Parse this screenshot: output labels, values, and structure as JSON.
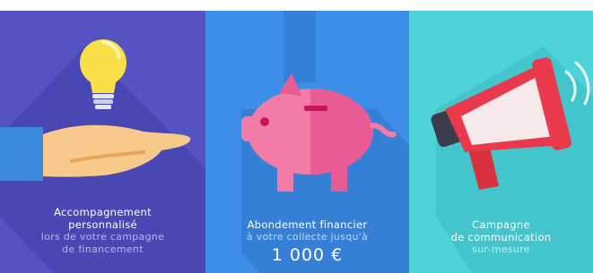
{
  "panels": [
    {
      "icon": "hand-holding-lightbulb-icon",
      "color": "#5553c4",
      "title_line1": "Accompagnement",
      "title_line2": "personnalisé",
      "sub_line1": "lors de votre campagne",
      "sub_line2": "de financement"
    },
    {
      "icon": "piggy-bank-icon",
      "color": "#3d8ee8",
      "title_line1": "Abondement financier",
      "sub_line1": "à votre collecte jusqu'à",
      "amount": "1 000 €"
    },
    {
      "icon": "megaphone-icon",
      "color": "#4fd2d8",
      "title_line1": "Campagne",
      "title_line2": "de communication",
      "sub_line1": "sur-mesure"
    }
  ]
}
